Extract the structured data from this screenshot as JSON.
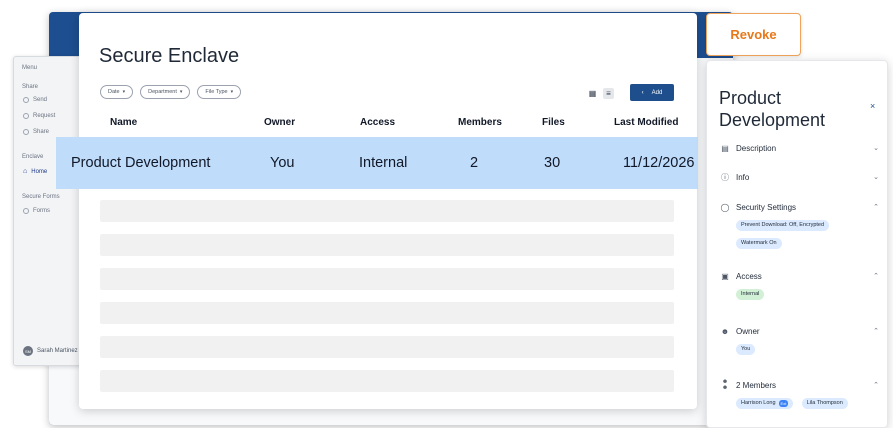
{
  "sidebar": {
    "menu_label": "Menu",
    "share_label": "Share",
    "share_items": [
      "Send",
      "Request",
      "Share"
    ],
    "enclave_label": "Enclave",
    "enclave_item": "Home",
    "secure_forms_label": "Secure Forms",
    "forms_item": "Forms",
    "user_name": "Sarah Martinez",
    "user_initials": "SM"
  },
  "main": {
    "title": "Secure Enclave",
    "filters": [
      "Date",
      "Department",
      "File Type"
    ],
    "add_label": "Add",
    "columns": [
      "Name",
      "Owner",
      "Access",
      "Members",
      "Files",
      "Last Modified"
    ],
    "row": {
      "name": "Product Development",
      "owner": "You",
      "access": "Internal",
      "members": "2",
      "files": "30",
      "last_modified": "11/12/2026"
    }
  },
  "revoke_label": "Revoke",
  "panel": {
    "title": "Product Development",
    "close_glyph": "×",
    "sections": {
      "description": "Description",
      "info": "Info",
      "security": "Security Settings",
      "security_chip1": "Prevent Download: Off, Encrypted",
      "security_chip2": "Watermark On",
      "access": "Access",
      "access_chip": "Internal",
      "owner": "Owner",
      "owner_chip": "You",
      "members": "2 Members",
      "member1": "Harrison Long",
      "member1_tag": "Ext",
      "member2": "Lila Thompson"
    }
  },
  "colors": {
    "brand_blue": "#1e4f8c",
    "highlight_row": "#bfdcfb",
    "revoke_orange": "#e8791b",
    "chip_blue": "#dbeafe",
    "chip_green": "#d1f0d5"
  }
}
